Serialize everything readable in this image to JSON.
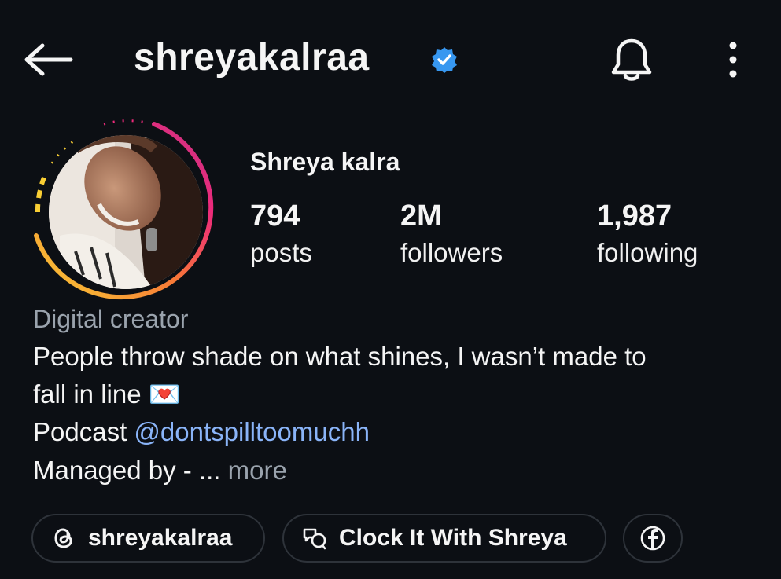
{
  "header": {
    "username": "shreyakalraa",
    "back_icon": "arrow-left-icon",
    "verified_icon": "verified-badge-icon",
    "notifications_icon": "bell-icon",
    "menu_icon": "more-vertical-icon"
  },
  "profile": {
    "display_name": "Shreya kalra",
    "avatar_ring_colors": [
      "#f9ce34",
      "#ee2a7b",
      "#6228d7"
    ]
  },
  "stats": [
    {
      "value": "794",
      "label": "posts"
    },
    {
      "value": "2M",
      "label": "followers"
    },
    {
      "value": "1,987",
      "label": "following"
    }
  ],
  "bio": {
    "category": "Digital creator",
    "line1": "People throw shade on what shines, I wasn’t made to",
    "line2": "fall in line",
    "line2_emoji": "💌",
    "podcast_prefix": "Podcast ",
    "podcast_handle": "@dontspilltoomuchh",
    "managed_prefix": "Managed by - ... ",
    "more": "more"
  },
  "chips": {
    "threads": {
      "label": "shreyakalraa",
      "icon": "threads-icon"
    },
    "channel": {
      "label": "Clock It With Shreya",
      "icon": "chat-bubbles-icon"
    },
    "facebook": {
      "icon": "facebook-icon"
    }
  },
  "colors": {
    "background": "#0c0f14",
    "link": "#8ab4f8",
    "muted": "#9aa3ad",
    "verified": "#3797f0"
  }
}
